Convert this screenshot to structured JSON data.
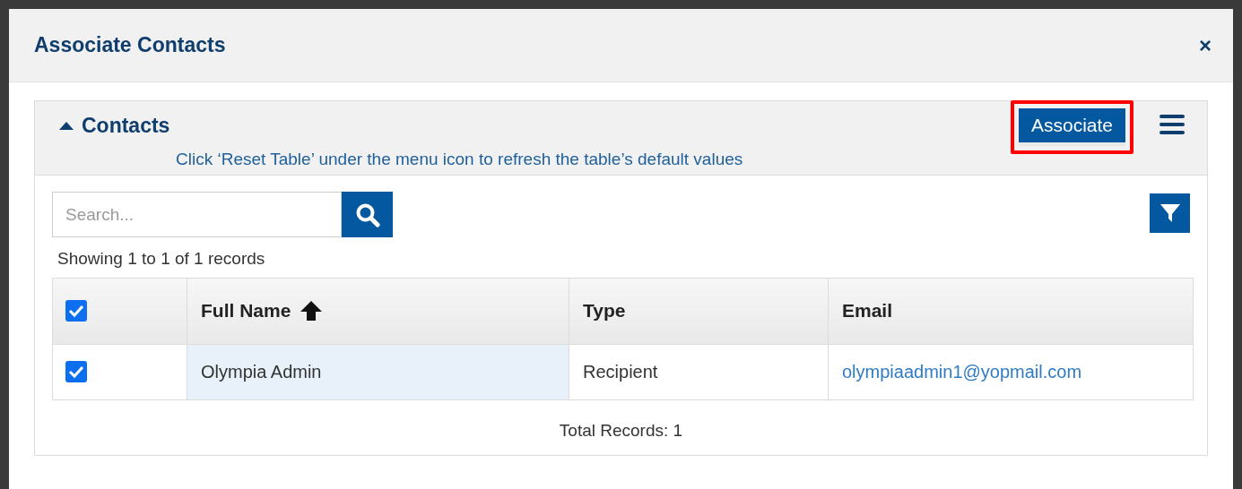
{
  "dialog": {
    "title": "Associate Contacts",
    "close": "×"
  },
  "panel": {
    "title": "Contacts",
    "expanded": true,
    "hint": "Click ‘Reset Table’ under the menu icon to refresh the table’s default values",
    "associate_button": "Associate",
    "highlighted": true
  },
  "search": {
    "placeholder": "Search..."
  },
  "summary": "Showing 1 to 1 of 1 records",
  "table": {
    "select_all_checked": true,
    "columns": [
      {
        "label": "Full Name",
        "sorted": true
      },
      {
        "label": "Type",
        "sorted": false
      },
      {
        "label": "Email",
        "sorted": false
      }
    ],
    "rows": [
      {
        "checked": true,
        "cells": [
          "Olympia Admin",
          "Recipient",
          "olympiaadmin1@yopmail.com"
        ]
      }
    ]
  },
  "total": "Total Records: 1"
}
